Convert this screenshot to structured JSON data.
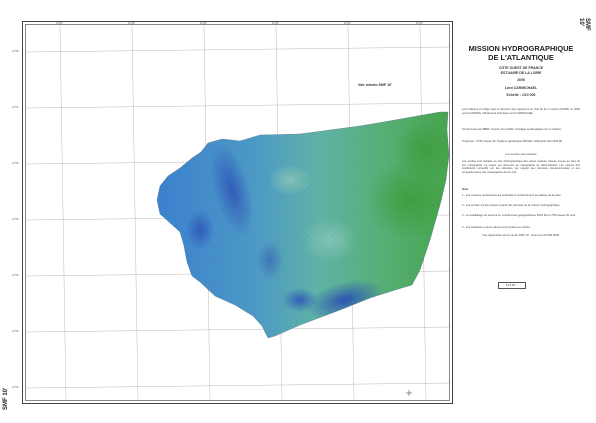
{
  "map": {
    "series_code": "SMF 10'",
    "series_code_bottom": "SMF 10'",
    "vignette_label": "Voir minute SMF 10'",
    "title_line1": "MISSION HYDROGRAPHIQUE",
    "title_line2": "DE L'ATLANTIQUE",
    "region_line1": "CÔTE OUEST DE FRANCE",
    "region_line2": "ESTUAIRE DE LA LOIRE",
    "year": "2006",
    "survey_ship": "Lord CARMICHAEL",
    "scale": "Echelle : 1/10 000",
    "stamp_text": "12.5.06 ...",
    "colors": {
      "frame": "#444444",
      "grid": "#b8b8b8",
      "deep": "#3a6fc4",
      "mid": "#5aa0c8",
      "shallow": "#5fb878",
      "shoal": "#4aa84a"
    }
  },
  "legend": {
    "intro": "Levé effectué et rédigé sous la direction des ingénieurs en chef de 2e cl. Hydro (SHOM) en 2006 sous la DIRNAV. Affrètement technique   Lord CARMICHAEL.",
    "line2": "Sonde levée par MBES. Sonde non-vérifiée. Sondage systématique mis en lumière.",
    "projection": "Projection : UTM, fuseau 30. Système géodésique WGS84 - Ellipsoïde IAG-GRS 80.",
    "soundings_title": "Les sondes sont réduites",
    "soundings_body": "Les sondes sont réduites au zéro hydrographique des cartes marines. Niveau moyen au zéro du 1er marégraphe. La marée est observée au marégraphe de Saint-Nazaire. Les valeurs des coefficients correctifs ont été calculées par rapport aux données conventionnelles et aux enregistrements des marégraphes de la Loire.",
    "notes_title": "Nota",
    "notes": [
      "1 - Les couleurs représentent les profondeurs conformément au tableau de la carte.",
      "2 - Les sondes ont été portées à partir des données de la mission hydrographique.",
      "3 - Le quadrillage est exprimé en coordonnées géographiques WGS 84 et UTM fuseau 30 nord.",
      "4 - Les isobathes et leurs valeurs sont portées en mètres."
    ],
    "footer": "Vue rapprochée de la minute SMF 10' ; levé au 1/10 000 2006."
  },
  "grid_labels": {
    "top": [
      "01°50'",
      "01°48'",
      "01°46'",
      "01°44'",
      "01°42'",
      "01°40'"
    ],
    "left": [
      "47°08'",
      "47°07'",
      "47°06'",
      "47°05'",
      "47°04'",
      "47°03'",
      "47°02'"
    ]
  }
}
